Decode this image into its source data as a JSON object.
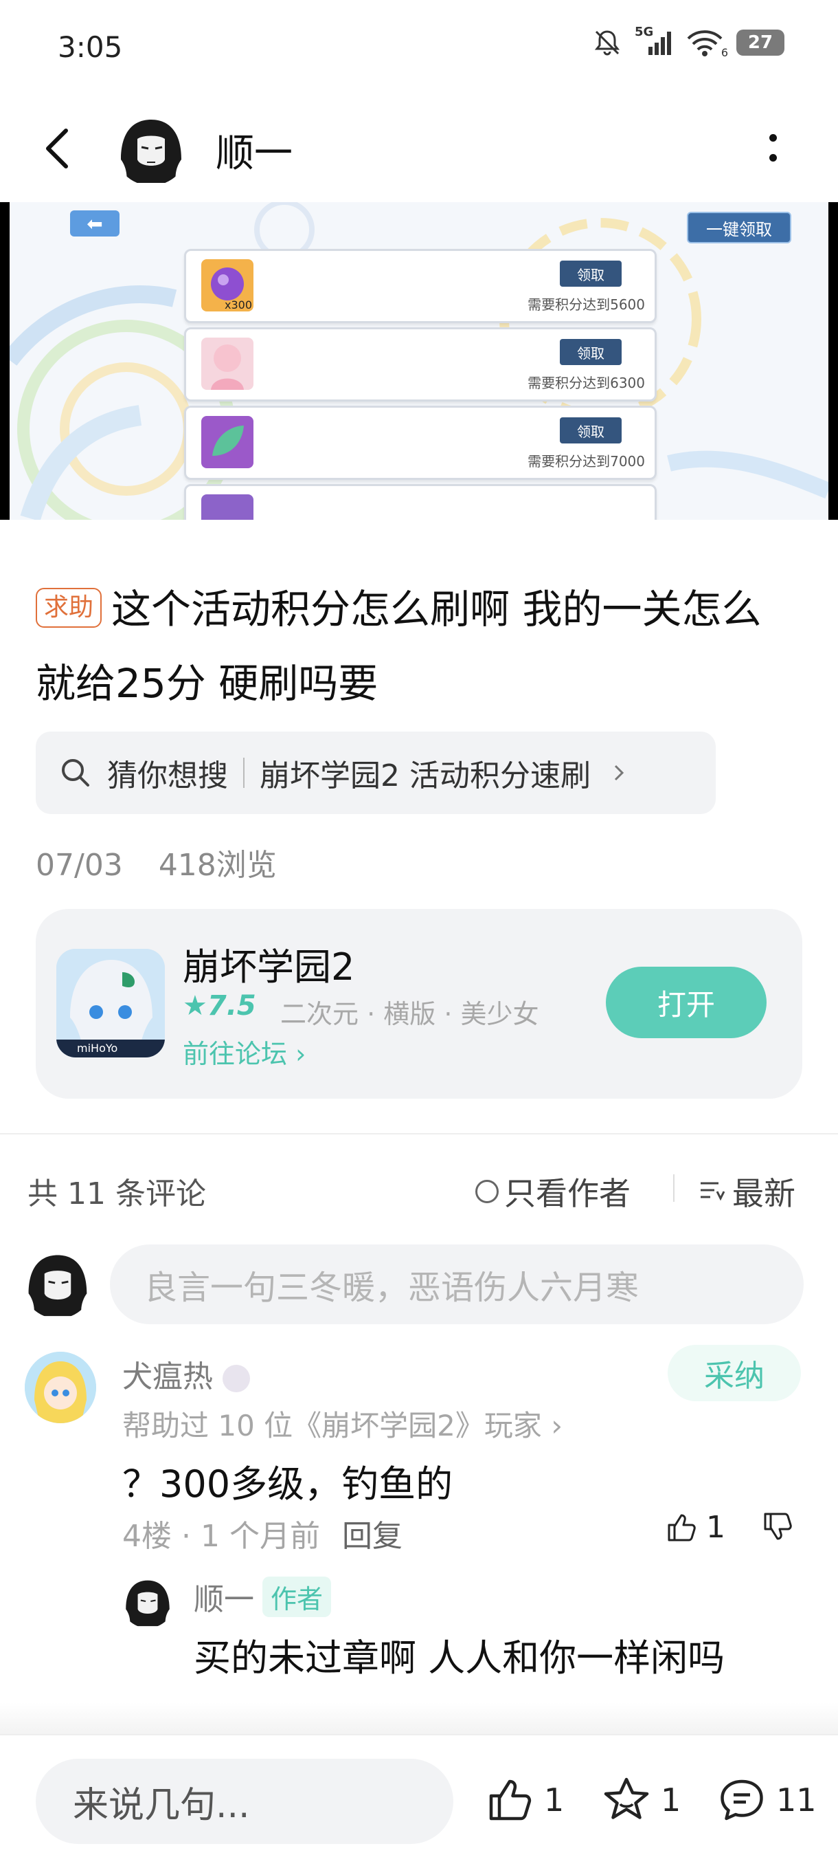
{
  "status_bar": {
    "time": "3:05",
    "network": "5G",
    "wifi_sub": "6",
    "battery": "27"
  },
  "header": {
    "user_name": "顺一"
  },
  "banner": {
    "onekey_label": "一键领取",
    "rows": [
      {
        "claim": "领取",
        "requirement": "需要积分达到5600",
        "badge": "x300"
      },
      {
        "claim": "领取",
        "requirement": "需要积分达到6300",
        "badge": ""
      },
      {
        "claim": "领取",
        "requirement": "需要积分达到7000",
        "badge": ""
      }
    ]
  },
  "post": {
    "tag": "求助",
    "title": "这个活动积分怎么刷啊 我的一关怎么就给25分 硬刷吗要",
    "suggest_prefix": "猜你想搜",
    "suggest_query": "崩坏学园2 活动积分速刷",
    "date": "07/03",
    "views": "418浏览"
  },
  "game_card": {
    "name": "崩坏学园2",
    "rating": "7.5",
    "tags": "二次元 · 横版 · 美少女",
    "forum_link": "前往论坛",
    "open_label": "打开",
    "icon_text": "miHoYo"
  },
  "comments_header": {
    "count": "共 11 条评论",
    "author_only": "只看作者",
    "sort": "最新"
  },
  "comment_input": {
    "placeholder": "良言一句三冬暖，恶语伤人六月寒"
  },
  "comments": [
    {
      "user": "犬瘟热",
      "adopt_label": "采纳",
      "helped": "帮助过 10 位《崩坏学园2》玩家",
      "text": "？300多级，钓鱼的",
      "floor": "4楼",
      "time": "1 个月前",
      "reply_label": "回复",
      "likes": "1",
      "reply": {
        "user": "顺一",
        "badge": "作者",
        "text": "买的未过章啊 人人和你一样闲吗"
      }
    }
  ],
  "bottom_bar": {
    "say_placeholder": "来说几句...",
    "likes": "1",
    "favorites": "1",
    "comments": "11"
  }
}
